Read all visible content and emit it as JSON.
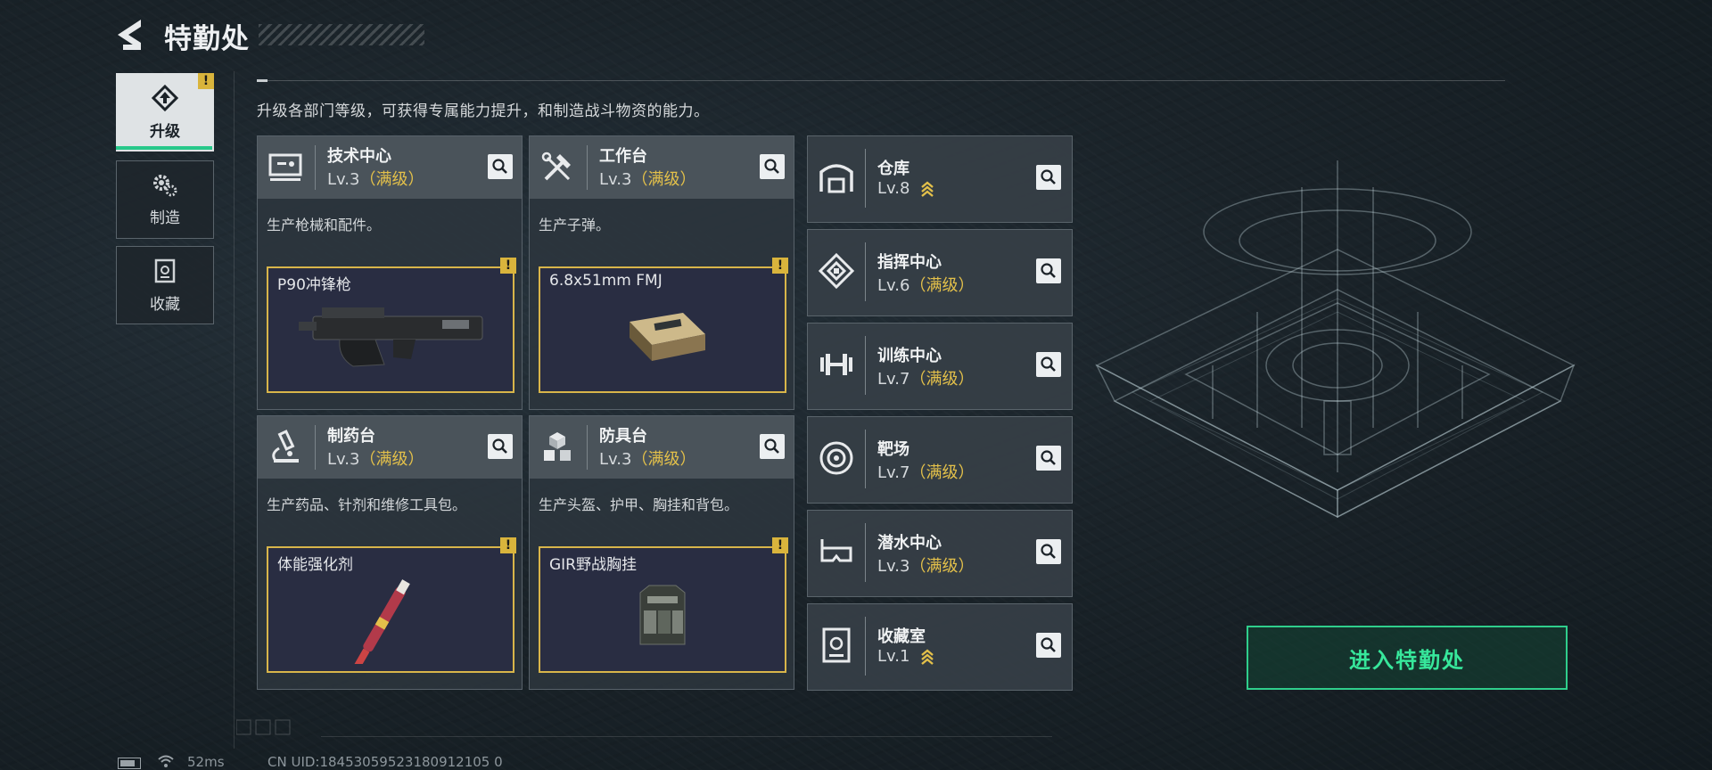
{
  "header": {
    "title": "特勤处"
  },
  "tabs": [
    {
      "label": "升级",
      "alert": "!"
    },
    {
      "label": "制造"
    },
    {
      "label": "收藏"
    }
  ],
  "description": "升级各部门等级，可获得专属能力提升，和制造战斗物资的能力。",
  "cards": [
    {
      "name": "技术中心",
      "level": "Lv.3",
      "status": "（满级）",
      "desc": "生产枪械和配件。",
      "item": "P90冲锋枪",
      "alert": "!"
    },
    {
      "name": "工作台",
      "level": "Lv.3",
      "status": "（满级）",
      "desc": "生产子弹。",
      "item": "6.8x51mm FMJ",
      "alert": "!"
    },
    {
      "name": "制药台",
      "level": "Lv.3",
      "status": "（满级）",
      "desc": "生产药品、针剂和维修工具包。",
      "item": "体能强化剂",
      "alert": "!"
    },
    {
      "name": "防具台",
      "level": "Lv.3",
      "status": "（满级）",
      "desc": "生产头盔、护甲、胸挂和背包。",
      "item": "GIR野战胸挂",
      "alert": "!"
    }
  ],
  "facilities": [
    {
      "name": "仓库",
      "level": "Lv.8",
      "status": "",
      "icon": "garage-icon",
      "upgradable": true
    },
    {
      "name": "指挥中心",
      "level": "Lv.6",
      "status": "（满级）",
      "icon": "command-chip-icon",
      "upgradable": false
    },
    {
      "name": "训练中心",
      "level": "Lv.7",
      "status": "（满级）",
      "icon": "dumbbell-icon",
      "upgradable": false
    },
    {
      "name": "靶场",
      "level": "Lv.7",
      "status": "（满级）",
      "icon": "target-icon",
      "upgradable": false
    },
    {
      "name": "潜水中心",
      "level": "Lv.3",
      "status": "（满级）",
      "icon": "diving-mask-icon",
      "upgradable": false
    },
    {
      "name": "收藏室",
      "level": "Lv.1",
      "status": "",
      "icon": "collection-icon",
      "upgradable": true
    }
  ],
  "enter_button": "进入特勤处",
  "status_bar": {
    "ping": "52ms",
    "uid": "CN UID:18453059523180912105 0"
  },
  "colors": {
    "accent_green": "#2fce8c",
    "max_gold": "#e3c04a",
    "alert_yellow": "#d9b43c"
  }
}
